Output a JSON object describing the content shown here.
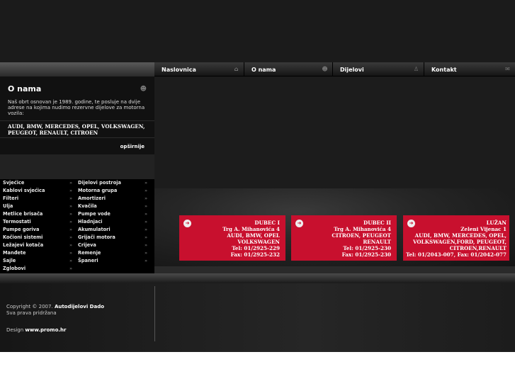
{
  "nav": [
    {
      "label": "Naslovnica",
      "icon": "home-icon"
    },
    {
      "label": "O nama",
      "icon": "people-icon"
    },
    {
      "label": "Dijelovi",
      "icon": "parts-icon"
    },
    {
      "label": "Kontakt",
      "icon": "mail-icon"
    }
  ],
  "about": {
    "title": "O nama",
    "text": "Naš obrt osnovan je 1989. godine, te posluje na dvije adrese na kojima nudimo rezervne dijelove za motorna vozila:",
    "brands": "AUDI, BMW, MERCEDES, OPEL, VOLKSWAGEN, PEUGEOT, RENAULT, CITROEN",
    "more": "opširnije"
  },
  "categories_left": [
    "Svjećice",
    "Kablovi svjećica",
    "Filteri",
    "Ulja",
    "Metlice brisača",
    "Termostati",
    "Pumpe goriva",
    "Kočioni sistemi",
    "Ležajevi kotača",
    "Manđete",
    "Sajle",
    "Zglobovi"
  ],
  "categories_right": [
    "Dijelovi postroja",
    "Motorna grupa",
    "Amortizeri",
    "Kvačila",
    "Pumpe vode",
    "Hladnjaci",
    "Akumulatori",
    "Grijači motora",
    "Crijeva",
    "Remenje",
    "Španeri"
  ],
  "arrow": "»",
  "addresses": [
    {
      "name": "DUBEC I",
      "street": "Trg A. Mihanovića 4",
      "brands1": "AUDI, BMW, OPEL",
      "brands2": "VOLKSWAGEN",
      "brands3": "",
      "tel": "Tel: 01/2925-229",
      "fax": "Fax: 01/2925-232"
    },
    {
      "name": "DUBEC II",
      "street": "Trg A. Mihanovića 4",
      "brands1": "CITROEN, PEUGEOT",
      "brands2": "RENAULT",
      "brands3": "",
      "tel": "Tel: 01/2925-230",
      "fax": "Fax: 01/2925-230"
    },
    {
      "name": "LUŽAN",
      "street": "Zeleni Vijenac 1",
      "brands1": "AUDI, BMW, MERCEDES, OPEL,",
      "brands2": "VOLKSWAGEN,FORD, PEUGEOT,",
      "brands3": "CITROEN,RENAULT",
      "tel": "Tel: 01/2043-007, Fax: 01/2042-077",
      "fax": ""
    }
  ],
  "footer": {
    "copyright_prefix": "Copyright © 2007.",
    "company": "Autodijelovi Dado",
    "rights": "Sva prava pridržana",
    "design_prefix": "Design",
    "designer": "www.promo.hr"
  },
  "colors": {
    "accent": "#c8102e",
    "background": "#1a1a1a"
  }
}
